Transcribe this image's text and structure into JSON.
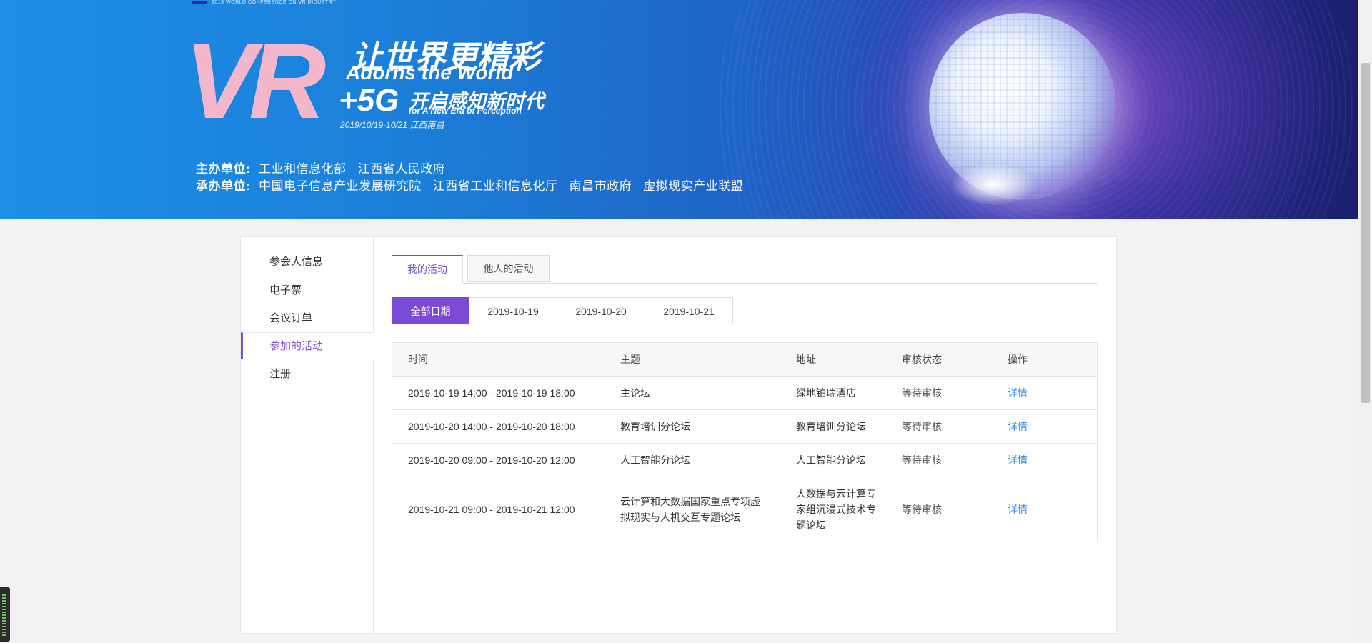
{
  "banner": {
    "top_tag": "2019 WORLD CONFERENCE ON VR INDUSTRY",
    "logo_vr": "VR",
    "slogan_cn1": "让世界更精彩",
    "slogan_en1": "Adorns the World",
    "slogan_5g": "+5G",
    "slogan_cn2": "开启感知新时代",
    "slogan_en2": "for A New Era of Perception",
    "date_location": "2019/10/19-10/21  江西南昌",
    "host_label": "主办单位:",
    "hosts": [
      "工业和信息化部",
      "江西省人民政府"
    ],
    "organizer_label": "承办单位:",
    "organizers": [
      "中国电子信息产业发展研究院",
      "江西省工业和信息化厅",
      "南昌市政府",
      "虚拟现实产业联盟"
    ]
  },
  "sidebar": {
    "items": [
      {
        "label": "参会人信息"
      },
      {
        "label": "电子票"
      },
      {
        "label": "会议订单"
      },
      {
        "label": "参加的活动",
        "active": true
      },
      {
        "label": "注册"
      }
    ]
  },
  "tabs": [
    {
      "label": "我的活动",
      "active": true
    },
    {
      "label": "他人的活动"
    }
  ],
  "date_filters": [
    {
      "label": "全部日期",
      "active": true
    },
    {
      "label": "2019-10-19"
    },
    {
      "label": "2019-10-20"
    },
    {
      "label": "2019-10-21"
    }
  ],
  "table": {
    "headers": [
      "时间",
      "主题",
      "地址",
      "审核状态",
      "操作"
    ],
    "rows": [
      {
        "time": "2019-10-19 14:00 - 2019-10-19 18:00",
        "topic": "主论坛",
        "address": "绿地铂瑞酒店",
        "status": "等待审核",
        "action": "详情"
      },
      {
        "time": "2019-10-20 14:00 - 2019-10-20 18:00",
        "topic": "教育培训分论坛",
        "address": "教育培训分论坛",
        "status": "等待审核",
        "action": "详情"
      },
      {
        "time": "2019-10-20 09:00 - 2019-10-20 12:00",
        "topic": "人工智能分论坛",
        "address": "人工智能分论坛",
        "status": "等待审核",
        "action": "详情"
      },
      {
        "time": "2019-10-21 09:00 - 2019-10-21 12:00",
        "topic": "云计算和大数据国家重点专项虚拟现实与人机交互专题论坛",
        "address": "大数据与云计算专家组沉浸式技术专题论坛",
        "status": "等待审核",
        "action": "详情"
      }
    ]
  },
  "colors": {
    "accent": "#7b4bd6",
    "link": "#3a8ee6",
    "banner_start": "#1e8fe6",
    "banner_end": "#1b1f6e"
  }
}
